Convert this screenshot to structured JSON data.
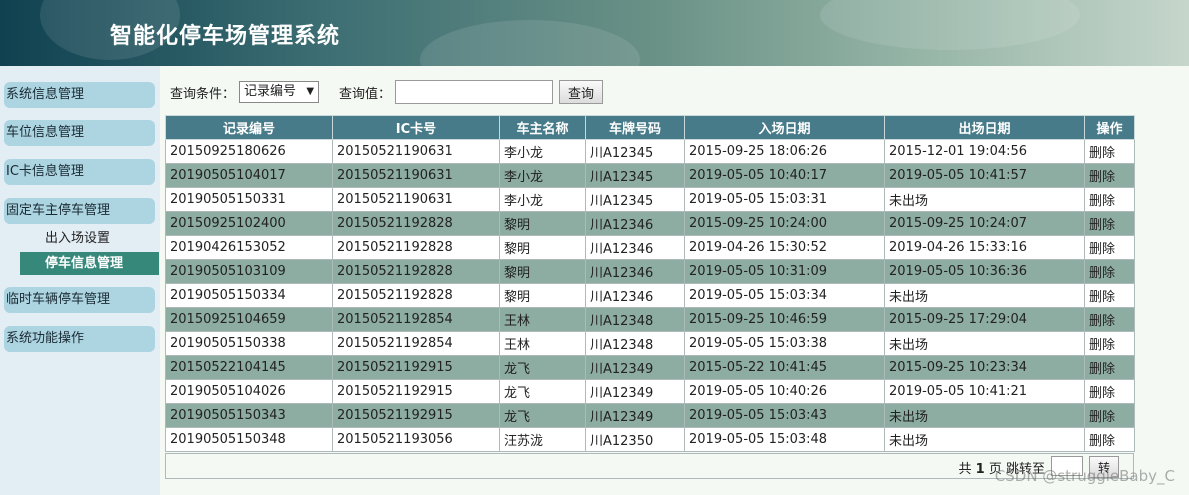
{
  "header": {
    "title": "智能化停车场管理系统"
  },
  "sidebar": {
    "items": [
      {
        "label": "系统信息管理"
      },
      {
        "label": "车位信息管理"
      },
      {
        "label": "IC卡信息管理"
      },
      {
        "label": "固定车主停车管理"
      },
      {
        "label": "临时车辆停车管理"
      },
      {
        "label": "系统功能操作"
      }
    ],
    "subitems": [
      {
        "label": "出入场设置"
      },
      {
        "label": "停车信息管理"
      }
    ]
  },
  "search": {
    "condition_label": "查询条件：",
    "condition_value": "记录编号",
    "value_label": "查询值：",
    "value_input": "",
    "button": "查询"
  },
  "table": {
    "headers": [
      "记录编号",
      "IC卡号",
      "车主名称",
      "车牌号码",
      "入场日期",
      "出场日期",
      "操作"
    ],
    "rows": [
      [
        "20150925180626",
        "20150521190631",
        "李小龙",
        "川A12345",
        "2015-09-25 18:06:26",
        "2015-12-01 19:04:56",
        "删除"
      ],
      [
        "20190505104017",
        "20150521190631",
        "李小龙",
        "川A12345",
        "2019-05-05 10:40:17",
        "2019-05-05 10:41:57",
        "删除"
      ],
      [
        "20190505150331",
        "20150521190631",
        "李小龙",
        "川A12345",
        "2019-05-05 15:03:31",
        "未出场",
        "删除"
      ],
      [
        "20150925102400",
        "20150521192828",
        "黎明",
        "川A12346",
        "2015-09-25 10:24:00",
        "2015-09-25 10:24:07",
        "删除"
      ],
      [
        "20190426153052",
        "20150521192828",
        "黎明",
        "川A12346",
        "2019-04-26 15:30:52",
        "2019-04-26 15:33:16",
        "删除"
      ],
      [
        "20190505103109",
        "20150521192828",
        "黎明",
        "川A12346",
        "2019-05-05 10:31:09",
        "2019-05-05 10:36:36",
        "删除"
      ],
      [
        "20190505150334",
        "20150521192828",
        "黎明",
        "川A12346",
        "2019-05-05 15:03:34",
        "未出场",
        "删除"
      ],
      [
        "20150925104659",
        "20150521192854",
        "王林",
        "川A12348",
        "2015-09-25 10:46:59",
        "2015-09-25 17:29:04",
        "删除"
      ],
      [
        "20190505150338",
        "20150521192854",
        "王林",
        "川A12348",
        "2019-05-05 15:03:38",
        "未出场",
        "删除"
      ],
      [
        "20150522104145",
        "20150521192915",
        "龙飞",
        "川A12349",
        "2015-05-22 10:41:45",
        "2015-09-25 10:23:34",
        "删除"
      ],
      [
        "20190505104026",
        "20150521192915",
        "龙飞",
        "川A12349",
        "2019-05-05 10:40:26",
        "2019-05-05 10:41:21",
        "删除"
      ],
      [
        "20190505150343",
        "20150521192915",
        "龙飞",
        "川A12349",
        "2019-05-05 15:03:43",
        "未出场",
        "删除"
      ],
      [
        "20190505150348",
        "20150521193056",
        "汪苏泷",
        "川A12350",
        "2019-05-05 15:03:48",
        "未出场",
        "删除"
      ]
    ]
  },
  "pager": {
    "total_prefix": "共",
    "total_pages": "1",
    "total_suffix": "页 跳转至",
    "page_input": "",
    "go_button": "转"
  },
  "watermark": "CSDN @struggleBaby_C"
}
